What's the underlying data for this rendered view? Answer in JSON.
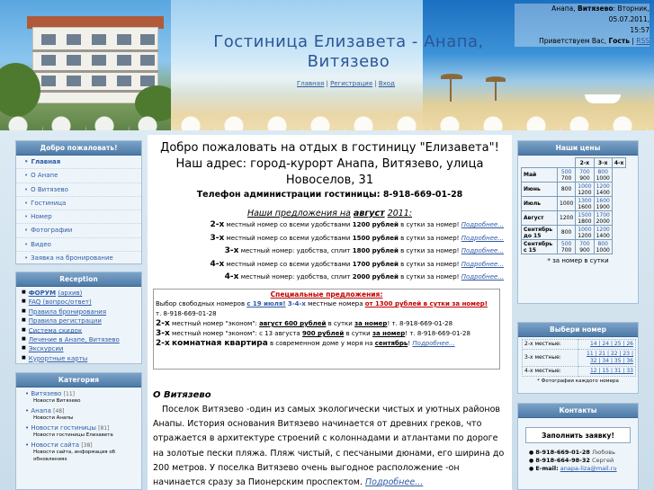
{
  "header": {
    "title": "Гостиница Елизавета - Анапа, Витязево",
    "nav": [
      {
        "label": "Главная"
      },
      {
        "label": "Регистрация"
      },
      {
        "label": "Вход"
      }
    ],
    "nav_sep": "|",
    "userbox": {
      "location_prefix": "Анапа,",
      "location_bold": "Витязево",
      "date": ": Вторник, 05.07.2011,",
      "time": "15:57",
      "greeting_prefix": "Приветствуем Вас,",
      "user": "Гость",
      "rss": "RSS"
    }
  },
  "sidebar_left": {
    "welcome": {
      "title": "Добро пожаловать!",
      "items": [
        {
          "label": "Главная"
        },
        {
          "label": "О Анапе"
        },
        {
          "label": "О Витязево"
        },
        {
          "label": "Гостиница"
        },
        {
          "label": "Номер"
        },
        {
          "label": "Фотографии"
        },
        {
          "label": "Видео"
        },
        {
          "label": "Заявка на бронирование"
        }
      ]
    },
    "reception": {
      "title": "Reception",
      "items": [
        {
          "label": "ФОРУМ",
          "extra": "(архив)"
        },
        {
          "label": "FAQ (вопрос/ответ)"
        },
        {
          "label": "Правила бронирования"
        },
        {
          "label": "Правила регистрации"
        },
        {
          "label": "Система скидок"
        },
        {
          "label": "Лечение в Анапе, Витязево"
        },
        {
          "label": "Экскурсии"
        },
        {
          "label": "Курортные карты"
        }
      ]
    },
    "category": {
      "title": "Категория",
      "items": [
        {
          "label": "Витязево",
          "count": "[11]",
          "sub": "Новости Витязево"
        },
        {
          "label": "Анапа",
          "count": "[48]",
          "sub": "Новости Анапы"
        },
        {
          "label": "Новости гостиницы",
          "count": "[81]",
          "sub": "Новости гостиницы Елизавета"
        },
        {
          "label": "Новости сайта",
          "count": "[38]",
          "sub": "Новости сайта, информация об обновлениях"
        }
      ]
    }
  },
  "main": {
    "welcome_line1": "Добро пожаловать на отдых в гостиницу \"Елизавета\"!",
    "welcome_line2": "Наш адрес: город-курорт Анапа, Витязево, улица Новоселов, 31",
    "phone_line": "Телефон администрации гостиницы: 8-918-669-01-28",
    "offers_title_prefix": "Наши предложения на",
    "offers_title_month": "август",
    "offers_title_year": "2011:",
    "more_label": "Подробнее...",
    "offers": [
      {
        "type": "2-х",
        "text_pre": "местный номер со всеми удобствами",
        "price": "1200 рублей",
        "text_post": "в сутки за номер!"
      },
      {
        "type": "3-х",
        "text_pre": "местный номер со всеми удобствами",
        "price": "1500 рублей",
        "text_post": "в сутки за номер!"
      },
      {
        "type": "3-х",
        "text_pre": "местный номер: удобства, сплит",
        "price": "1800 рублей",
        "text_post": "в сутки за номер!"
      },
      {
        "type": "4-х",
        "text_pre": "местный номер со всеми удобствами",
        "price": "1700 рублей",
        "text_post": "в сутки за номер!"
      },
      {
        "type": "4-х",
        "text_pre": "местный номер: удобства, сплит",
        "price": "2000 рублей",
        "text_post": "в сутки за номер!"
      }
    ],
    "special": {
      "title": "Специальные предложения:",
      "line1_a": "Выбор свободных номеров",
      "line1_b": "с 19 июля!",
      "line1_c": "3-4-х",
      "line1_d": "местные номера",
      "line1_e": "от 1300 рублей в сутки за номер!",
      "line1_phone": "т. 8-918-669-01-28",
      "line2_type": "2-х",
      "line2_a": "местный номер \"эконом\":",
      "line2_b": "август 600 рублей",
      "line2_c": "в сутки",
      "line2_d": "за номер",
      "line2_phone": "! т. 8-918-669-01-28",
      "line3_type": "3-х",
      "line3_a": "местный номер \"эконом\": с 13 августа",
      "line3_b": "900 рублей",
      "line3_c": "в сутки",
      "line3_d": "за номер",
      "line3_phone": "! т. 8-918-669-01-28",
      "line4_type": "2-х",
      "line4_a": "комнатная квартира",
      "line4_b": "в современном доме у моря на",
      "line4_c": "сентябрь",
      "line4_d": "!"
    },
    "about_title": "О Витязево",
    "about_text": "Поселок Витязево -один из самых экологически чистых и уютных районов Анапы. История основания Витязево начинается от древних греков, что отражается в архитектуре строений с колоннадами и атлантами по дороге на золотые пески пляжа. Пляж чистый, с песчаными дюнами, его ширина до 200 метров. У поселка Витязево очень выгодное расположение -он начинается сразу за Пионерским проспектом."
  },
  "sidebar_right": {
    "prices": {
      "title": "Наши цены",
      "columns": [
        "",
        "",
        "2-х",
        "3-х",
        "4-х"
      ],
      "rows": [
        {
          "month": "Май",
          "single": "",
          "c2": [
            "500",
            "700"
          ],
          "c3": [
            "700",
            "900"
          ],
          "c4": [
            "800",
            "1000"
          ]
        },
        {
          "month": "Июнь",
          "single": "800",
          "c2": [],
          "c3": [
            "1000",
            "1200"
          ],
          "c4": [
            "1200",
            "1400"
          ]
        },
        {
          "month": "Июль",
          "single": "1000",
          "c2": [],
          "c3": [
            "1300",
            "1600"
          ],
          "c4": [
            "1600",
            "1900"
          ]
        },
        {
          "month": "Август",
          "single": "1200",
          "c2": [],
          "c3": [
            "1500",
            "1800"
          ],
          "c4": [
            "1700",
            "2000"
          ]
        },
        {
          "month": "Сентябрь до 15",
          "single": "800",
          "c2": [],
          "c3": [
            "1000",
            "1200"
          ],
          "c4": [
            "1200",
            "1400"
          ]
        },
        {
          "month": "Сентябрь с 15",
          "single": "",
          "c2": [
            "500",
            "700"
          ],
          "c3": [
            "700",
            "900"
          ],
          "c4": [
            "800",
            "1000"
          ]
        }
      ],
      "note": "* за номер в сутки"
    },
    "rooms": {
      "title": "Выбери номер",
      "rows": [
        {
          "label": "2-х местные:",
          "nums": "14 | 24 | 25 | 26"
        },
        {
          "label": "3-х местные:",
          "nums": "11 | 21 | 22 | 23 | 32 | 34 | 35 | 36"
        },
        {
          "label": "4-х местные:",
          "nums": "12 | 15 | 31 | 33"
        }
      ],
      "note": "* Фотографии каждого номера"
    },
    "contacts": {
      "title": "Контакты",
      "order_button": "Заполнить заявку!",
      "phone1": "8-918-669-01-28",
      "phone1_name": "Любовь",
      "phone2": "8-918-664-98-32",
      "phone2_name": "Сергей",
      "email_label": "E-mail:",
      "email": "anapa-liza@mail.ru"
    }
  }
}
